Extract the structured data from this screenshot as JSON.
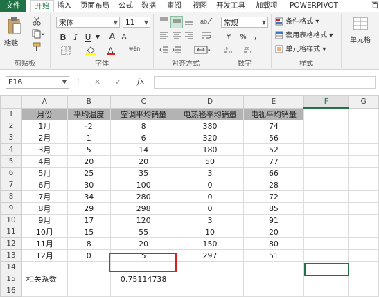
{
  "ribbon_tabs": [
    "文件",
    "开始",
    "插入",
    "页面布局",
    "公式",
    "数据",
    "审阅",
    "视图",
    "开发工具",
    "加载项",
    "POWERPIVOT",
    "百"
  ],
  "clipboard": {
    "paste_label": "粘贴",
    "group_label": "剪贴板"
  },
  "font": {
    "name": "宋体",
    "size": "11",
    "bold": "B",
    "italic": "I",
    "underline": "U",
    "grow": "A",
    "shrink": "A",
    "group_label": "字体",
    "wen": "wén"
  },
  "alignment": {
    "group_label": "对齐方式"
  },
  "number": {
    "format": "常规",
    "currency": "¥",
    "percent": "%",
    "comma": ",",
    "group_label": "数字"
  },
  "styles": {
    "conditional": "条件格式",
    "table": "套用表格格式",
    "cell": "单元格样式",
    "group_label": "样式"
  },
  "cells": {
    "label": "单元格"
  },
  "formula_bar": {
    "name_box": "F16",
    "cancel": "✕",
    "enter": "✓",
    "fx": "fx",
    "formula": ""
  },
  "columns": [
    "A",
    "B",
    "C",
    "D",
    "E",
    "F",
    "G"
  ],
  "header_row": [
    "月份",
    "平均温度",
    "空调平均销量",
    "电热毯平均销量",
    "电视平均销量"
  ],
  "rows": [
    {
      "n": "2",
      "cells": [
        "1月",
        "-2",
        "8",
        "380",
        "74"
      ]
    },
    {
      "n": "3",
      "cells": [
        "2月",
        "1",
        "6",
        "320",
        "56"
      ]
    },
    {
      "n": "4",
      "cells": [
        "3月",
        "5",
        "14",
        "180",
        "52"
      ]
    },
    {
      "n": "5",
      "cells": [
        "4月",
        "20",
        "20",
        "50",
        "77"
      ]
    },
    {
      "n": "6",
      "cells": [
        "5月",
        "25",
        "35",
        "3",
        "66"
      ]
    },
    {
      "n": "7",
      "cells": [
        "6月",
        "30",
        "100",
        "0",
        "28"
      ]
    },
    {
      "n": "8",
      "cells": [
        "7月",
        "34",
        "280",
        "0",
        "72"
      ]
    },
    {
      "n": "9",
      "cells": [
        "8月",
        "29",
        "298",
        "0",
        "85"
      ]
    },
    {
      "n": "10",
      "cells": [
        "9月",
        "17",
        "120",
        "3",
        "91"
      ]
    },
    {
      "n": "11",
      "cells": [
        "10月",
        "15",
        "55",
        "10",
        "20"
      ]
    },
    {
      "n": "12",
      "cells": [
        "11月",
        "8",
        "20",
        "150",
        "80"
      ]
    },
    {
      "n": "13",
      "cells": [
        "12月",
        "0",
        "5",
        "297",
        "51"
      ]
    }
  ],
  "row14": "14",
  "row15": {
    "n": "15",
    "label": "相关系数",
    "value": "0.75114738"
  },
  "row16": "16"
}
